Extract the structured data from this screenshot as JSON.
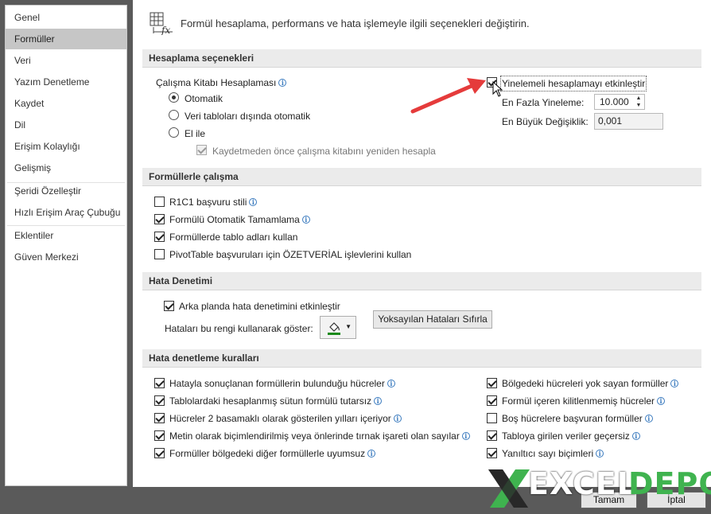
{
  "sidebar": {
    "items": [
      {
        "label": "Genel"
      },
      {
        "label": "Formüller"
      },
      {
        "label": "Veri"
      },
      {
        "label": "Yazım Denetleme"
      },
      {
        "label": "Kaydet"
      },
      {
        "label": "Dil"
      },
      {
        "label": "Erişim Kolaylığı"
      },
      {
        "label": "Gelişmiş"
      },
      {
        "label": "Şeridi Özelleştir"
      },
      {
        "label": "Hızlı Erişim Araç Çubuğu"
      },
      {
        "label": "Eklentiler"
      },
      {
        "label": "Güven Merkezi"
      }
    ],
    "selected": "Formüller"
  },
  "header": {
    "text": "Formül hesaplama, performans ve hata işlemeyle ilgili seçenekleri değiştirin.",
    "icon": "formula-calc-icon"
  },
  "calc": {
    "section_title": "Hesaplama seçenekleri",
    "workbook_label": "Çalışma Kitabı Hesaplaması",
    "radio_auto": "Otomatik",
    "radio_auto_except": "Veri tabloları dışında otomatik",
    "radio_manual": "El ile",
    "recalc_before_save": "Kaydetmeden önce çalışma kitabını yeniden hesapla",
    "iterative": "Yinelemeli hesaplamayı etkinleştir",
    "max_iter_label": "En Fazla Yineleme:",
    "max_iter_value": "10.000",
    "max_change_label": "En Büyük Değişiklik:",
    "max_change_value": "0,001"
  },
  "formulas": {
    "section_title": "Formüllerle çalışma",
    "items": [
      {
        "label": "R1C1 başvuru stili",
        "checked": false,
        "info": true
      },
      {
        "label": "Formülü Otomatik Tamamlama",
        "checked": true,
        "info": true
      },
      {
        "label": "Formüllerde tablo adları kullan",
        "checked": true,
        "info": false
      },
      {
        "label": "PivotTable başvuruları için ÖZETVERİAL işlevlerini kullan",
        "checked": false,
        "info": false
      }
    ]
  },
  "errors": {
    "section_title": "Hata Denetimi",
    "background_check": "Arka planda hata denetimini etkinleştir",
    "color_label": "Hataları bu rengi kullanarak göster:",
    "reset_button": "Yoksayılan Hataları Sıfırla",
    "color_value": "#1a8a1a"
  },
  "rules": {
    "section_title": "Hata denetleme kuralları",
    "left": [
      {
        "label": "Hatayla sonuçlanan formüllerin bulunduğu hücreler",
        "checked": true
      },
      {
        "label": "Tablolardaki hesaplanmış sütun formülü tutarsız",
        "checked": true
      },
      {
        "label": "Hücreler 2 basamaklı olarak gösterilen yılları içeriyor",
        "checked": true
      },
      {
        "label": "Metin olarak biçimlendirilmiş veya önlerinde tırnak işareti olan sayılar",
        "checked": true
      },
      {
        "label": "Formüller bölgedeki diğer formüllerle uyumsuz",
        "checked": true
      }
    ],
    "right": [
      {
        "label": "Bölgedeki hücreleri yok sayan formüller",
        "checked": true
      },
      {
        "label": "Formül içeren kilitlenmemiş hücreler",
        "checked": true
      },
      {
        "label": "Boş hücrelere başvuran formüller",
        "checked": false
      },
      {
        "label": "Tabloya girilen veriler geçersiz",
        "checked": true
      },
      {
        "label": "Yanıltıcı sayı biçimleri",
        "checked": true
      }
    ]
  },
  "footer": {
    "ok": "Tamam",
    "cancel": "İptal"
  },
  "watermark": {
    "part1": "EXCEL",
    "part2": "DEPO",
    "color1": "#ffffff",
    "color2": "#3fb34f"
  }
}
